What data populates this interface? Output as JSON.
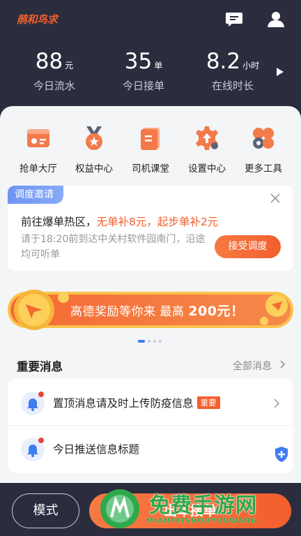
{
  "header": {
    "logo": "鹃和鸟求",
    "icons": [
      "message-icon",
      "user-icon"
    ]
  },
  "stats": [
    {
      "value": "88",
      "unit": "元",
      "label": "今日流水"
    },
    {
      "value": "35",
      "unit": "单",
      "label": "今日接单"
    },
    {
      "value": "8.2",
      "unit": "小时",
      "label": "在线时长"
    }
  ],
  "tools": [
    {
      "label": "抢单大厅",
      "icon": "order-hall-icon"
    },
    {
      "label": "权益中心",
      "icon": "medal-icon"
    },
    {
      "label": "司机课堂",
      "icon": "book-icon"
    },
    {
      "label": "设置中心",
      "icon": "gear-icon"
    },
    {
      "label": "更多工具",
      "icon": "more-tools-icon"
    }
  ],
  "invite": {
    "tag": "调度邀请",
    "title_prefix": "前往爆单热区，",
    "title_highlight": "无单补8元，起步单补2元",
    "description": "请于18:20前到达中关村软件园南门，沿途均可听单",
    "accept_label": "接受调度"
  },
  "banner": {
    "text": "高德奖励等你来 最高 ",
    "amount": "200元！"
  },
  "carousel": {
    "count": 4,
    "active_index": 0
  },
  "messages": {
    "title": "重要消息",
    "more_label": "全部消息",
    "items": [
      {
        "text": "置顶消息请及时上传防疫信息",
        "badge": "重要"
      },
      {
        "text": "今日推送信息标题",
        "badge": ""
      }
    ]
  },
  "bottom": {
    "mode_label": "模式",
    "start_label": "出车接单"
  },
  "watermark": {
    "text": "免费手游网",
    "sub": "MIANFEISHOUYOUWANG"
  },
  "colors": {
    "header_bg": "#2b2d3f",
    "accent_orange": "#f25f2c",
    "tag_blue": "#6e95f2",
    "page_bg": "#f4f5f7"
  }
}
